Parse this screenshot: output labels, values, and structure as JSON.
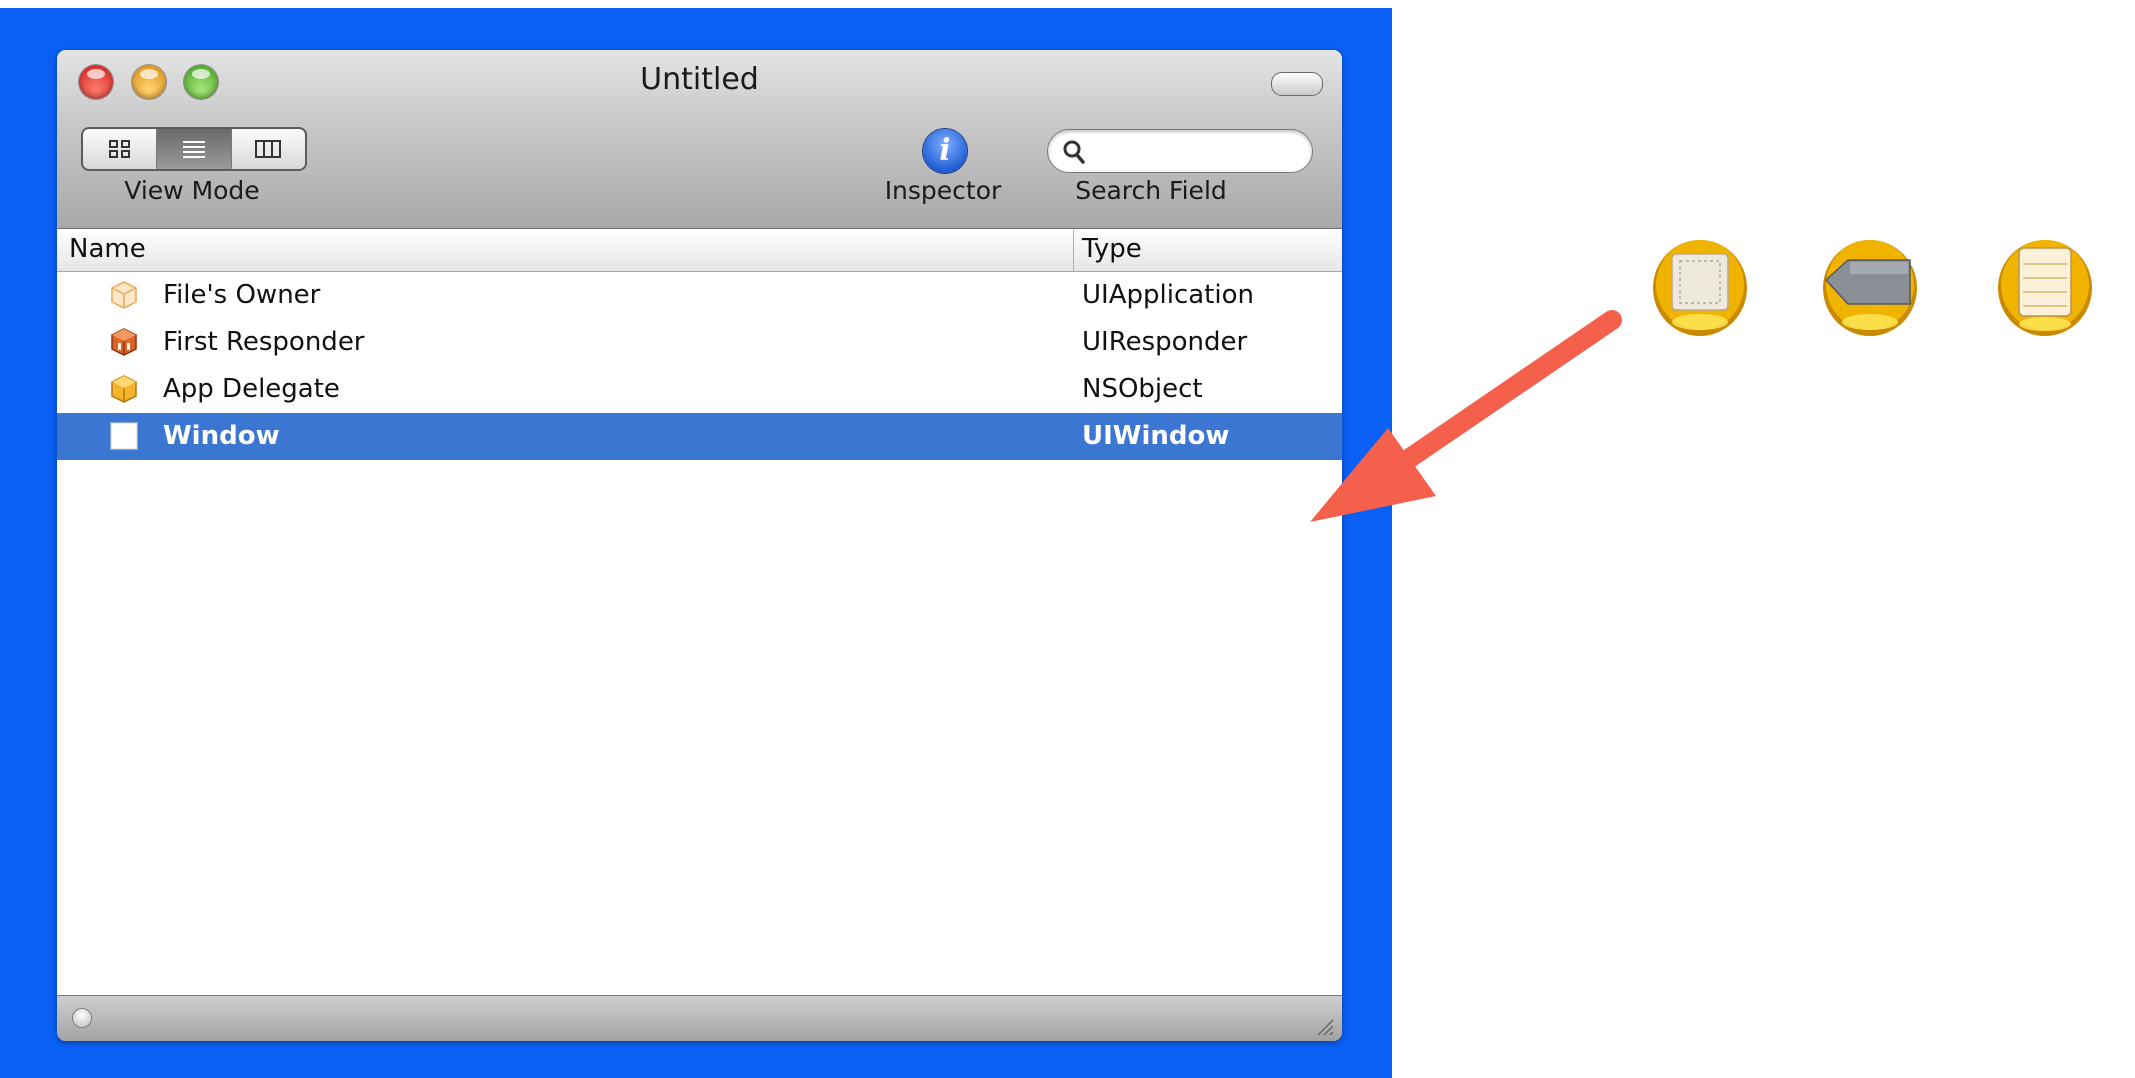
{
  "window": {
    "title": "Untitled"
  },
  "toolbar": {
    "view_mode_label": "View Mode",
    "inspector_label": "Inspector",
    "search_label": "Search Field",
    "search_value": "",
    "info_glyph": "i"
  },
  "table": {
    "columns": [
      "Name",
      "Type"
    ],
    "rows": [
      {
        "name": "File's Owner",
        "type": "UIApplication",
        "icon": "transparent-cube-icon"
      },
      {
        "name": "First Responder",
        "type": "UIResponder",
        "icon": "red-cube-icon"
      },
      {
        "name": "App Delegate",
        "type": "NSObject",
        "icon": "yellow-cube-icon"
      },
      {
        "name": "Window",
        "type": "UIWindow",
        "icon": "window-icon",
        "selected": true
      }
    ]
  },
  "colors": {
    "frame_blue": "#0a5ff4",
    "selection_blue": "#3c76d3",
    "arrow_red": "#f5604d",
    "icon_gold": "#f0b400"
  },
  "icons": [
    "view-mode-icon-view",
    "view-mode-list",
    "view-mode-columns",
    "info-icon",
    "search-icon",
    "object-view-icon",
    "object-tag-icon",
    "object-list-icon"
  ]
}
